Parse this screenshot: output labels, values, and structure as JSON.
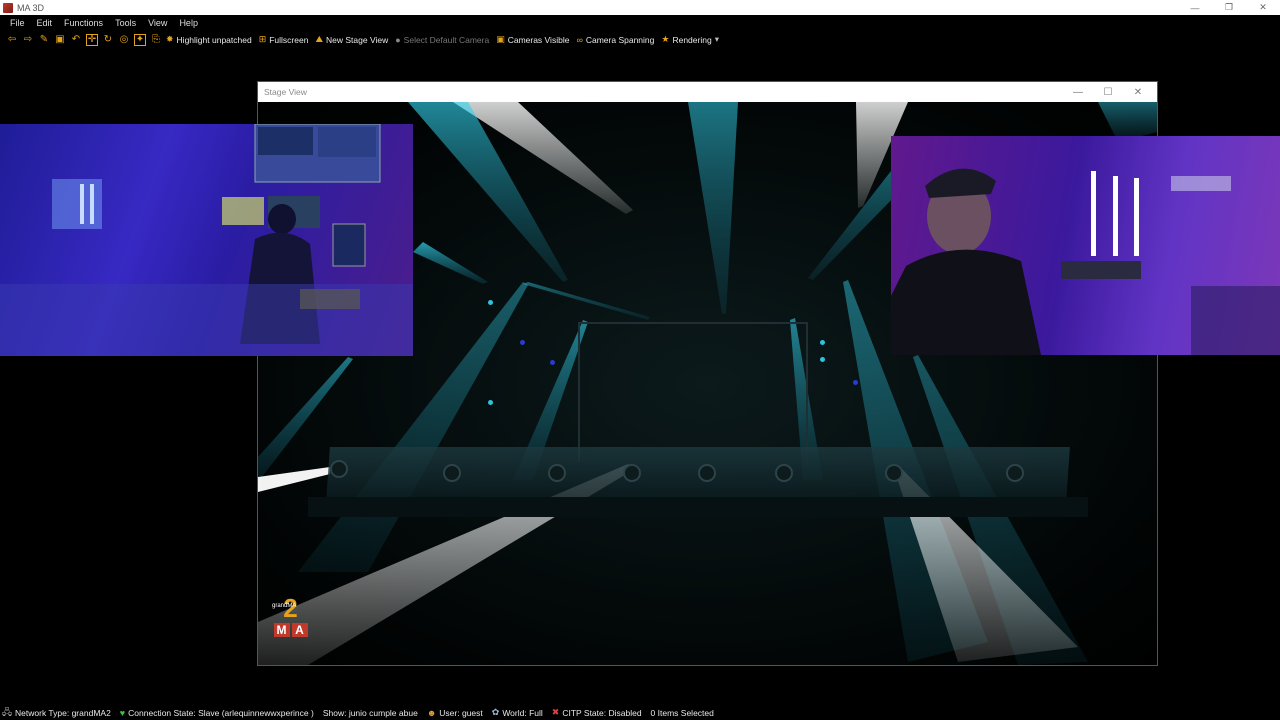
{
  "window": {
    "title": "MA 3D",
    "controls": [
      "—",
      "❐",
      "✕"
    ]
  },
  "menu": [
    "File",
    "Edit",
    "Functions",
    "Tools",
    "View",
    "Help"
  ],
  "toolbar": {
    "icons": [
      {
        "name": "arrow-left-icon",
        "glyph": "⇦"
      },
      {
        "name": "arrow-right-icon",
        "glyph": "⇨"
      },
      {
        "name": "open-icon",
        "glyph": "✎"
      },
      {
        "name": "save-icon",
        "glyph": "▣"
      },
      {
        "name": "undo-icon",
        "glyph": "↶"
      },
      {
        "name": "move-icon",
        "glyph": "✛"
      },
      {
        "name": "rotate-icon",
        "glyph": "↻"
      },
      {
        "name": "target-icon",
        "glyph": "◎"
      },
      {
        "name": "fixture-add-icon",
        "glyph": "✦"
      },
      {
        "name": "export-icon",
        "glyph": "⎘"
      }
    ],
    "items": [
      {
        "label": "Highlight unpatched",
        "glyph": "✸",
        "disabled": false,
        "name": "highlight-unpatched-button"
      },
      {
        "label": "Fullscreen",
        "glyph": "⊞",
        "disabled": false,
        "name": "fullscreen-button"
      },
      {
        "label": "New Stage View",
        "glyph": "⛰",
        "disabled": false,
        "name": "new-stage-view-button"
      },
      {
        "label": "Select Default Camera",
        "glyph": "●",
        "disabled": true,
        "name": "select-default-camera-button"
      },
      {
        "label": "Cameras Visible",
        "glyph": "▣",
        "disabled": false,
        "name": "cameras-visible-button"
      },
      {
        "label": "Camera Spanning",
        "glyph": "∞",
        "disabled": false,
        "name": "camera-spanning-button"
      },
      {
        "label": "Rendering",
        "glyph": "★",
        "disabled": false,
        "name": "rendering-button",
        "dropdown": "▾"
      }
    ]
  },
  "stage_view": {
    "title": "Stage View",
    "controls": [
      "—",
      "☐",
      "✕"
    ],
    "logo": {
      "number": "2",
      "brand": "grandMA",
      "letters": [
        "M",
        "A"
      ]
    }
  },
  "status": [
    {
      "name": "network-type",
      "glyph": "🖧",
      "text": "Network Type: grandMA2",
      "color": "#bbbbbb"
    },
    {
      "name": "connection-state",
      "glyph": "♥",
      "text": "Connection State: Slave (arlequinnewwxperince )",
      "color": "#43c043"
    },
    {
      "name": "show-name",
      "glyph": "",
      "text": "Show: junio cumple abue",
      "color": "#ffffff"
    },
    {
      "name": "user",
      "glyph": "☻",
      "text": "User: guest",
      "color": "#e3a31b"
    },
    {
      "name": "world",
      "glyph": "✿",
      "text": "World: Full",
      "color": "#9fb7d9"
    },
    {
      "name": "citp-state",
      "glyph": "✖",
      "text": "CITP State: Disabled",
      "color": "#e04040"
    },
    {
      "name": "items-selected",
      "glyph": "",
      "text": "0 Items Selected",
      "color": "#ffffff"
    }
  ],
  "colors": {
    "beam_cyan": "#2ec3dc",
    "beam_white": "#f2f2f2",
    "accent": "#e3a31b"
  }
}
